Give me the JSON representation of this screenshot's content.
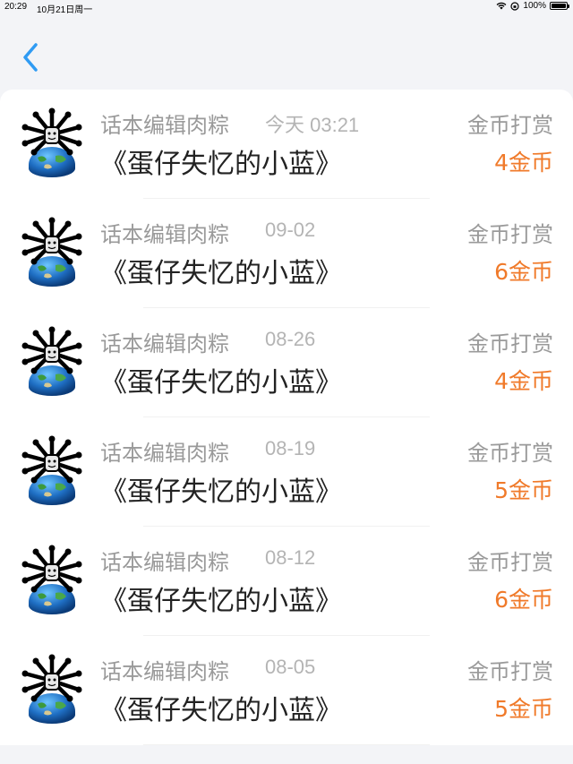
{
  "status_bar": {
    "time": "20:29",
    "date": "10月21日周一",
    "battery": "100%"
  },
  "nav": {
    "back_icon": "chevron-left-icon"
  },
  "colors": {
    "accent": "#2f9bf3",
    "reward": "#f07a2a",
    "muted": "#9a9a9a"
  },
  "items": [
    {
      "user": "话本编辑肉粽",
      "time": "今天 03:21",
      "title": "《蛋仔失忆的小蓝》",
      "reward_label": "金币打赏",
      "amount": "4金币"
    },
    {
      "user": "话本编辑肉粽",
      "time": "09-02",
      "title": "《蛋仔失忆的小蓝》",
      "reward_label": "金币打赏",
      "amount": "6金币"
    },
    {
      "user": "话本编辑肉粽",
      "time": "08-26",
      "title": "《蛋仔失忆的小蓝》",
      "reward_label": "金币打赏",
      "amount": "4金币"
    },
    {
      "user": "话本编辑肉粽",
      "time": "08-19",
      "title": "《蛋仔失忆的小蓝》",
      "reward_label": "金币打赏",
      "amount": "5金币"
    },
    {
      "user": "话本编辑肉粽",
      "time": "08-12",
      "title": "《蛋仔失忆的小蓝》",
      "reward_label": "金币打赏",
      "amount": "6金币"
    },
    {
      "user": "话本编辑肉粽",
      "time": "08-05",
      "title": "《蛋仔失忆的小蓝》",
      "reward_label": "金币打赏",
      "amount": "5金币"
    }
  ]
}
